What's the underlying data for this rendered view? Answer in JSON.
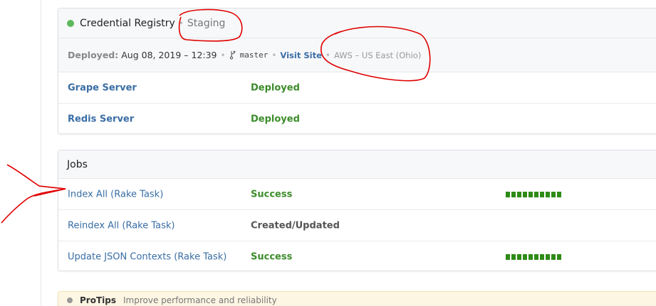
{
  "app": {
    "status_color": "#5cb85c",
    "title": "Credential Registry",
    "environment": "Staging",
    "deploy": {
      "label": "Deployed:",
      "date": "Aug 08, 2019 – 12:39",
      "branch": "master",
      "visit_link": "Visit Site",
      "region": "AWS – US East (Ohio)"
    },
    "services": [
      {
        "name": "Grape Server",
        "status": "Deployed"
      },
      {
        "name": "Redis Server",
        "status": "Deployed"
      }
    ]
  },
  "jobs": {
    "title": "Jobs",
    "items": [
      {
        "name": "Index All (Rake Task)",
        "status": "Success",
        "progress_segments": 10
      },
      {
        "name": "Reindex All (Rake Task)",
        "status": "Created/Updated",
        "progress_segments": 0
      },
      {
        "name": "Update JSON Contexts (Rake Task)",
        "status": "Success",
        "progress_segments": 10
      }
    ]
  },
  "tips": {
    "title": "ProTips",
    "description": "Improve performance and reliability"
  },
  "colors": {
    "link": "#3a6ea5",
    "success": "#3c8c2b",
    "annotation": "#e00000"
  }
}
